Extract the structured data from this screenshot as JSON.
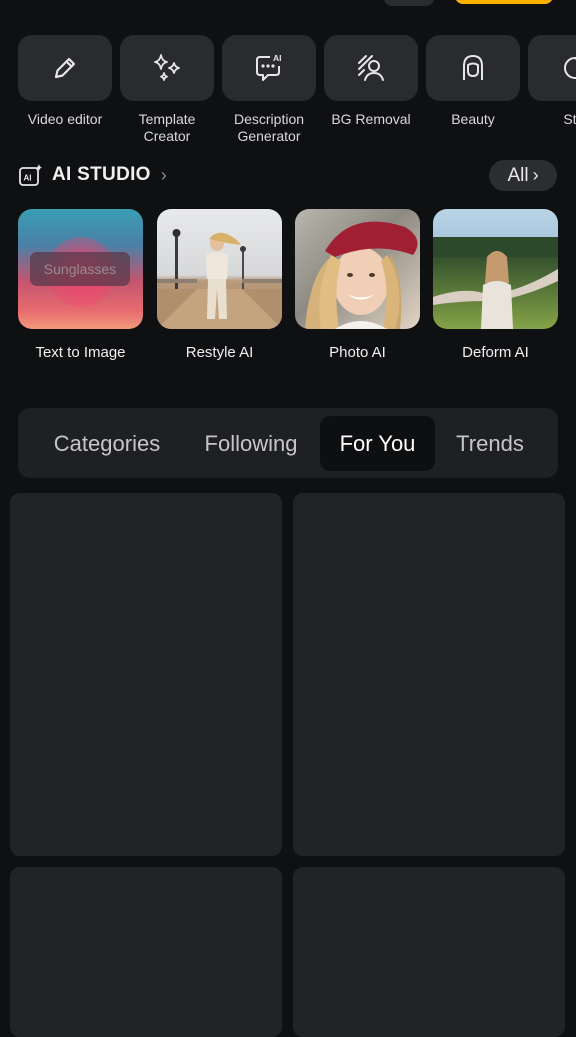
{
  "tools": [
    {
      "label": "Video editor",
      "icon": "pencil-icon"
    },
    {
      "label": "Template\nCreator",
      "icon": "sparkles-icon"
    },
    {
      "label": "Description\nGenerator",
      "icon": "ai-chat-icon"
    },
    {
      "label": "BG Removal",
      "icon": "person-cutout-icon"
    },
    {
      "label": "Beauty",
      "icon": "face-icon"
    },
    {
      "label": "Stic",
      "icon": "sticker-icon"
    }
  ],
  "ai_studio": {
    "title": "AI STUDIO",
    "all_label": "All",
    "cards": [
      {
        "label": "Text to Image",
        "overlay": "Sunglasses"
      },
      {
        "label": "Restyle AI"
      },
      {
        "label": "Photo AI"
      },
      {
        "label": "Deform AI"
      }
    ]
  },
  "tabs": [
    {
      "label": "Categories",
      "active": false
    },
    {
      "label": "Following",
      "active": false
    },
    {
      "label": "For You",
      "active": true
    },
    {
      "label": "Trends",
      "active": false
    }
  ],
  "colors": {
    "background": "#0f1012",
    "surface": "#2a2b2e",
    "accent": "#ffb300"
  }
}
